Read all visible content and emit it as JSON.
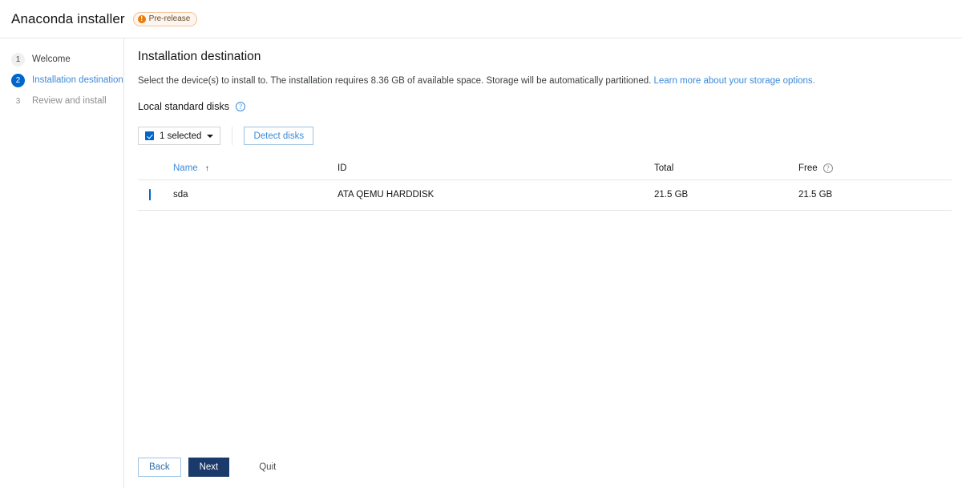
{
  "header": {
    "title": "Anaconda installer",
    "badge": {
      "label": "Pre-release",
      "icon": "exclamation-circle-icon",
      "glyph": "!",
      "color": "#ec7a08"
    }
  },
  "sidebar": {
    "steps": [
      {
        "number": "1",
        "label": "Welcome",
        "state": "done"
      },
      {
        "number": "2",
        "label": "Installation destination",
        "state": "active"
      },
      {
        "number": "3",
        "label": "Review and install",
        "state": "todo"
      }
    ]
  },
  "main": {
    "page_title": "Installation destination",
    "description_text": "Select the device(s) to install to. The installation requires 8.36 GB of available space. Storage will be automatically partitioned. ",
    "description_link": "Learn more about your storage options.",
    "section_title": "Local standard disks",
    "section_help_icon": "help-circle-icon",
    "toolbar": {
      "selected_label": "1 selected",
      "checkbox_checked": true,
      "caret_icon": "chevron-down-icon",
      "detect_disks_label": "Detect disks"
    },
    "table": {
      "columns": {
        "name": "Name",
        "id": "ID",
        "total": "Total",
        "free": "Free"
      },
      "sort_column": "Name",
      "sort_direction_icon": "arrow-up-icon",
      "sort_arrow_glyph": "↑",
      "free_help_icon": "help-circle-icon",
      "rows": [
        {
          "selected": true,
          "name": "sda",
          "id": "ATA QEMU HARDDISK",
          "total": "21.5 GB",
          "free": "21.5 GB"
        }
      ]
    }
  },
  "footer": {
    "back_label": "Back",
    "next_label": "Next",
    "quit_label": "Quit"
  },
  "colors": {
    "accent_blue": "#0066cc",
    "link_blue": "#3c8ad9",
    "primary_navy": "#1a3a6b",
    "badge_orange": "#ec7a08",
    "border": "#e6e6e6"
  }
}
